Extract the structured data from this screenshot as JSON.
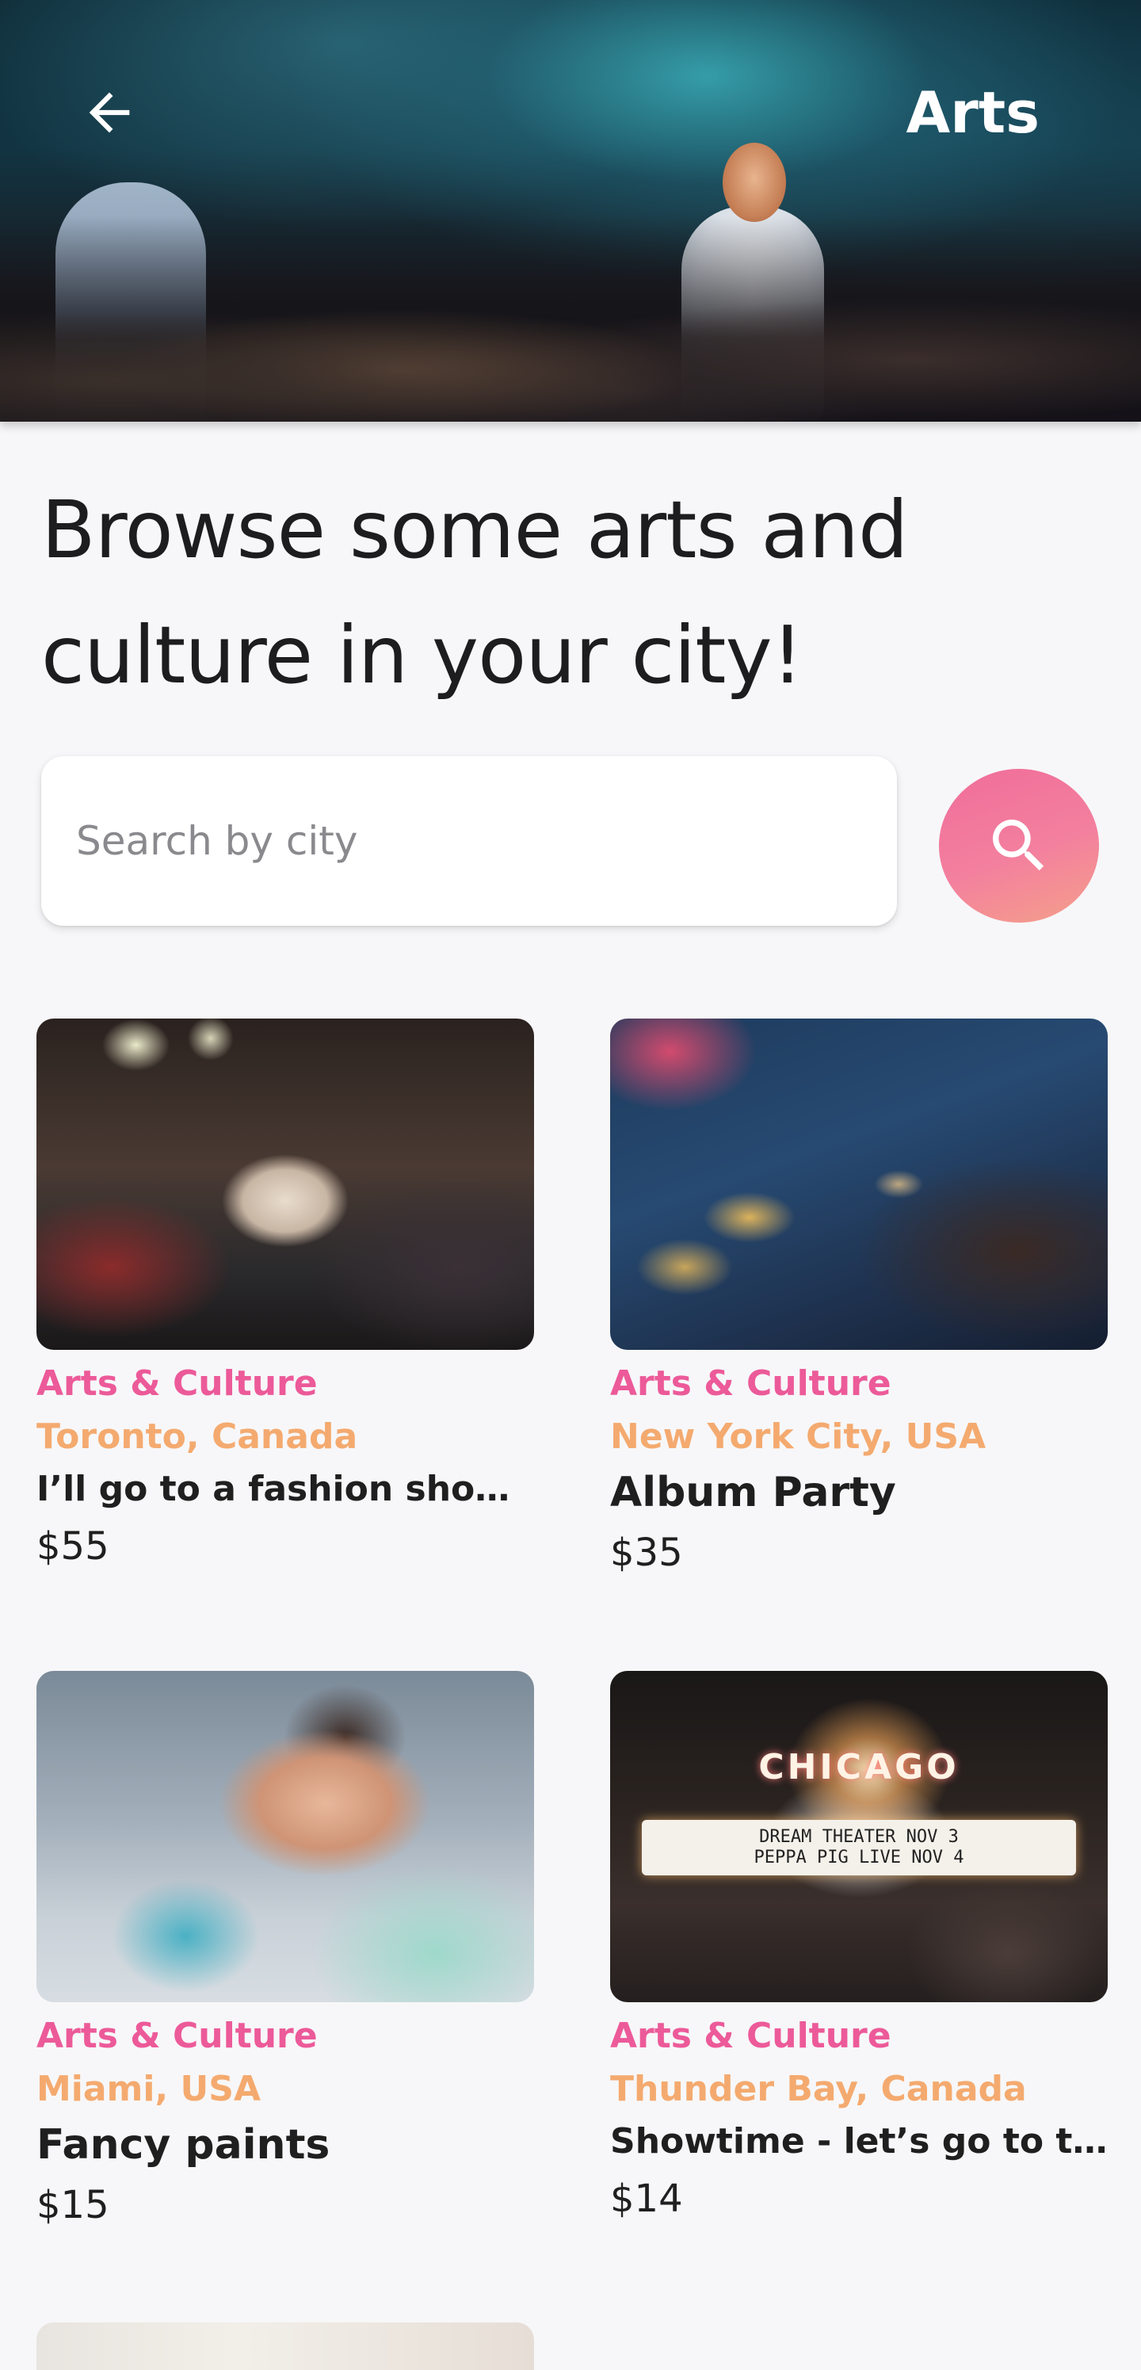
{
  "header": {
    "title": "Arts",
    "back_icon": "arrow-left-icon"
  },
  "headline": "Browse some arts and culture in your city!",
  "search": {
    "placeholder": "Search by city",
    "value": "",
    "button_icon": "search-icon",
    "button_gradient": [
      "#f06d9a",
      "#f5a08a"
    ]
  },
  "colors": {
    "category": "#ec5a99",
    "location": "#f4aa6f"
  },
  "cards": [
    {
      "category": "Arts & Culture",
      "location": "Toronto, Canada",
      "title": "I’ll go to a fashion show …",
      "price": "$55",
      "image": "fashion-runway-photo"
    },
    {
      "category": "Arts & Culture",
      "location": "New York City, USA",
      "title": "Album Party",
      "price": "$35",
      "image": "champagne-dinner-photo"
    },
    {
      "category": "Arts & Culture",
      "location": "Miami, USA",
      "title": "Fancy paints",
      "price": "$15",
      "image": "painter-woman-photo"
    },
    {
      "category": "Arts & Culture",
      "location": "Thunder Bay, Canada",
      "title": "Showtime - let’s go to the…",
      "price": "$14",
      "image": "chicago-theater-photo",
      "sign_text": "CHICAGO",
      "marquee_lines": [
        "DREAM THEATER NOV 3",
        "PEPPA PIG LIVE NOV 4"
      ]
    }
  ]
}
